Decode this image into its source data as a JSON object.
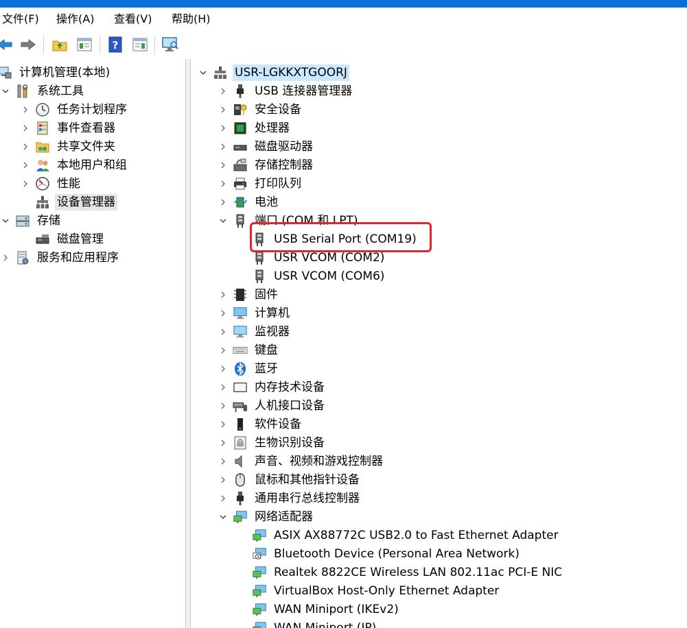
{
  "menu": {
    "file": "文件(F)",
    "action": "操作(A)",
    "view": "查看(V)",
    "help": "帮助(H)"
  },
  "left_tree": {
    "root": "计算机管理(本地)",
    "system_tools": "系统工具",
    "task_scheduler": "任务计划程序",
    "event_viewer": "事件查看器",
    "shared_folders": "共享文件夹",
    "local_users": "本地用户和组",
    "performance": "性能",
    "device_manager": "设备管理器",
    "storage": "存储",
    "disk_management": "磁盘管理",
    "services_apps": "服务和应用程序"
  },
  "device_tree": {
    "computer_name": "USR-LGKKXTGOORJ",
    "categories": [
      {
        "label": "USB 连接器管理器",
        "icon": "usb-plug-icon"
      },
      {
        "label": "安全设备",
        "icon": "security-key-icon"
      },
      {
        "label": "处理器",
        "icon": "processor-icon"
      },
      {
        "label": "磁盘驱动器",
        "icon": "disk-drive-icon"
      },
      {
        "label": "存储控制器",
        "icon": "storage-controller-icon"
      },
      {
        "label": "打印队列",
        "icon": "printer-icon"
      },
      {
        "label": "电池",
        "icon": "battery-icon"
      },
      {
        "label": "端口 (COM 和 LPT)",
        "icon": "port-icon"
      }
    ],
    "ports": [
      "USB Serial Port (COM19)",
      "USR VCOM (COM2)",
      "USR VCOM (COM6)"
    ],
    "categories2": [
      {
        "label": "固件",
        "icon": "firmware-icon"
      },
      {
        "label": "计算机",
        "icon": "computer-icon"
      },
      {
        "label": "监视器",
        "icon": "monitor-icon"
      },
      {
        "label": "键盘",
        "icon": "keyboard-icon"
      },
      {
        "label": "蓝牙",
        "icon": "bluetooth-icon"
      },
      {
        "label": "内存技术设备",
        "icon": "memory-icon"
      },
      {
        "label": "人机接口设备",
        "icon": "hid-icon"
      },
      {
        "label": "软件设备",
        "icon": "software-device-icon"
      },
      {
        "label": "生物识别设备",
        "icon": "fingerprint-icon"
      },
      {
        "label": "声音、视频和游戏控制器",
        "icon": "speaker-icon"
      },
      {
        "label": "鼠标和其他指针设备",
        "icon": "mouse-icon"
      },
      {
        "label": "通用串行总线控制器",
        "icon": "usb-controller-icon"
      },
      {
        "label": "网络适配器",
        "icon": "network-adapter-icon"
      }
    ],
    "network_adapters": [
      "ASIX AX88772C USB2.0 to Fast Ethernet Adapter",
      "Bluetooth Device (Personal Area Network)",
      "Realtek 8822CE Wireless LAN 802.11ac PCI-E NIC",
      "VirtualBox Host-Only Ethernet Adapter",
      "WAN Miniport (IKEv2)",
      "WAN Miniport (IP)"
    ]
  },
  "colors": {
    "titlebar": "#0a6fd6",
    "highlight": "#e0262a",
    "root_selection": "#cce8ff"
  }
}
